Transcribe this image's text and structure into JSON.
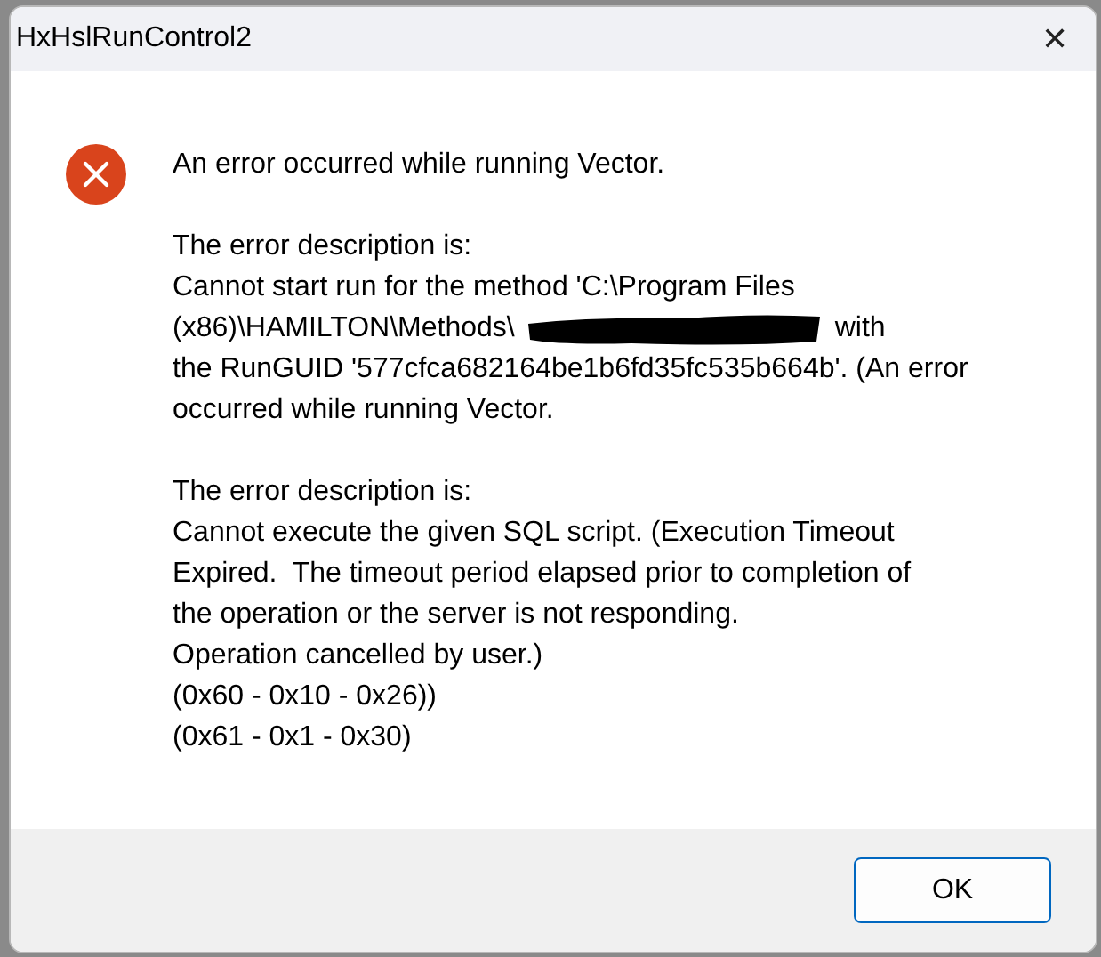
{
  "window": {
    "title": "HxHslRunControl2",
    "close": "✕"
  },
  "message": {
    "paragraphs": [
      {
        "lines": [
          {
            "kind": "text",
            "text": "An error occurred while running Vector."
          }
        ]
      },
      {
        "lines": [
          {
            "kind": "text",
            "text": "The error description is:"
          },
          {
            "kind": "text",
            "text": "Cannot start run for the method 'C:\\Program Files"
          },
          {
            "kind": "redacted",
            "before": "(x86)\\HAMILTON\\Methods\\",
            "after": "with"
          },
          {
            "kind": "text",
            "text": "the RunGUID '577cfca682164be1b6fd35fc535b664b'. (An error"
          },
          {
            "kind": "text",
            "text": "occurred while running Vector."
          }
        ]
      },
      {
        "lines": [
          {
            "kind": "text",
            "text": "The error description is:"
          },
          {
            "kind": "text",
            "text": "Cannot execute the given SQL script. (Execution Timeout"
          },
          {
            "kind": "text",
            "text": "Expired.  The timeout period elapsed prior to completion of"
          },
          {
            "kind": "text",
            "text": "the operation or the server is not responding."
          },
          {
            "kind": "text",
            "text": "Operation cancelled by user.)"
          },
          {
            "kind": "text",
            "text": "(0x60 - 0x10 - 0x26))"
          },
          {
            "kind": "text",
            "text": "(0x61 - 0x1 - 0x30)"
          }
        ]
      }
    ]
  },
  "buttons": [
    "OK"
  ]
}
